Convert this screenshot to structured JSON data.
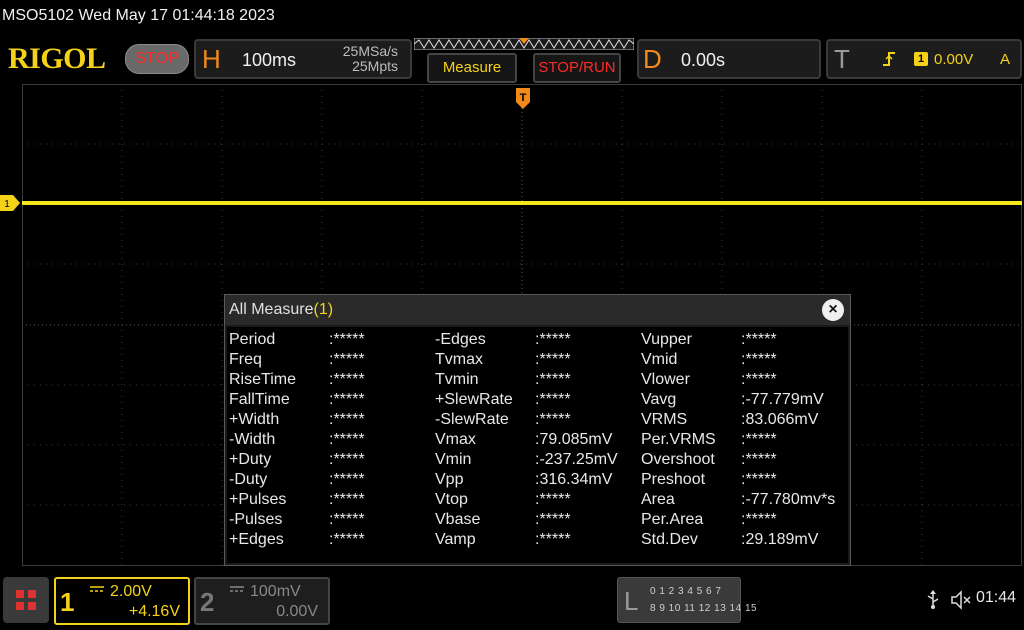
{
  "window": {
    "title": "MSO5102  Wed May 17 01:44:18 2023"
  },
  "brand": {
    "logo": "RIGOL",
    "run_state": "STOP"
  },
  "horizontal": {
    "letter": "H",
    "timebase": "100ms",
    "sample_rate": "25MSa/s",
    "memory_depth": "25Mpts"
  },
  "buttons": {
    "measure": "Measure",
    "stop_run": "STOP/RUN"
  },
  "delay": {
    "letter": "D",
    "value": "0.00s"
  },
  "trigger": {
    "letter": "T",
    "source": "1",
    "level": "0.00V",
    "mode": "A"
  },
  "trace": {
    "channel_marker": "1",
    "color": "#f5e81a"
  },
  "measure_window": {
    "title": "All Measure",
    "count": "(1)",
    "close": "×",
    "columns": [
      [
        {
          "name": "Period",
          "value": ":*****"
        },
        {
          "name": "Freq",
          "value": ":*****"
        },
        {
          "name": "RiseTime",
          "value": ":*****"
        },
        {
          "name": "FallTime",
          "value": ":*****"
        },
        {
          "name": "+Width",
          "value": ":*****"
        },
        {
          "name": "-Width",
          "value": ":*****"
        },
        {
          "name": "+Duty",
          "value": ":*****"
        },
        {
          "name": "-Duty",
          "value": ":*****"
        },
        {
          "name": "+Pulses",
          "value": ":*****"
        },
        {
          "name": "-Pulses",
          "value": ":*****"
        },
        {
          "name": "+Edges",
          "value": ":*****"
        }
      ],
      [
        {
          "name": "-Edges",
          "value": ":*****"
        },
        {
          "name": "Tvmax",
          "value": ":*****"
        },
        {
          "name": "Tvmin",
          "value": ":*****"
        },
        {
          "name": "+SlewRate",
          "value": ":*****"
        },
        {
          "name": "-SlewRate",
          "value": ":*****"
        },
        {
          "name": "Vmax",
          "value": ":79.085mV"
        },
        {
          "name": "Vmin",
          "value": ":-237.25mV"
        },
        {
          "name": "Vpp",
          "value": ":316.34mV"
        },
        {
          "name": "Vtop",
          "value": ":*****"
        },
        {
          "name": "Vbase",
          "value": ":*****"
        },
        {
          "name": "Vamp",
          "value": ":*****"
        }
      ],
      [
        {
          "name": "Vupper",
          "value": ":*****"
        },
        {
          "name": "Vmid",
          "value": ":*****"
        },
        {
          "name": "Vlower",
          "value": ":*****"
        },
        {
          "name": "Vavg",
          "value": ":-77.779mV"
        },
        {
          "name": "VRMS",
          "value": ":83.066mV"
        },
        {
          "name": "Per.VRMS",
          "value": ":*****"
        },
        {
          "name": "Overshoot",
          "value": ":*****"
        },
        {
          "name": "Preshoot",
          "value": ":*****"
        },
        {
          "name": "Area",
          "value": ":-77.780mv*s"
        },
        {
          "name": "Per.Area",
          "value": ":*****"
        },
        {
          "name": "Std.Dev",
          "value": ":29.189mV"
        }
      ]
    ]
  },
  "channel1": {
    "number": "1",
    "scale": "2.00V",
    "offset": "+4.16V"
  },
  "channel2": {
    "number": "2",
    "scale": "100mV",
    "offset": "0.00V"
  },
  "logic": {
    "letter": "L",
    "row1": "0 1 2 3   4 5 6 7",
    "row2": "8  9 10 11  12 13 14 15"
  },
  "status": {
    "time": "01:44"
  },
  "colors": {
    "accent": "#f5d21a",
    "alarm": "#ff2a2a"
  }
}
